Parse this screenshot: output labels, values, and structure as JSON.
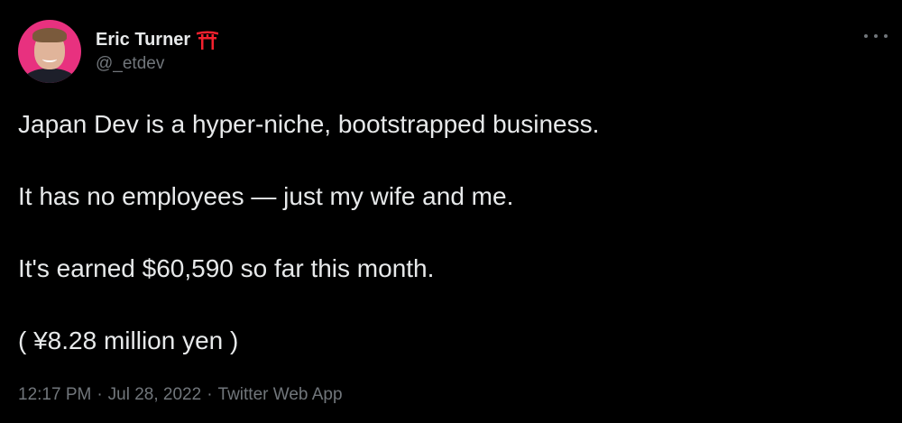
{
  "author": {
    "display_name": "Eric Turner",
    "handle": "@_etdev",
    "badge_icon": "torii-gate-icon",
    "avatar_bg": "#e8317f"
  },
  "menu_icon": "more-options-icon",
  "tweet": {
    "lines": [
      "Japan Dev is a hyper-niche, bootstrapped business.",
      "It has no employees — just my wife and me.",
      "It's earned $60,590 so far this month.",
      "( ¥8.28 million yen )"
    ]
  },
  "meta": {
    "time": "12:17 PM",
    "separator": "·",
    "date": "Jul 28, 2022",
    "source": "Twitter Web App"
  },
  "colors": {
    "background": "#000000",
    "text": "#e7e9ea",
    "muted": "#71767b",
    "torii": "#f4212e"
  }
}
